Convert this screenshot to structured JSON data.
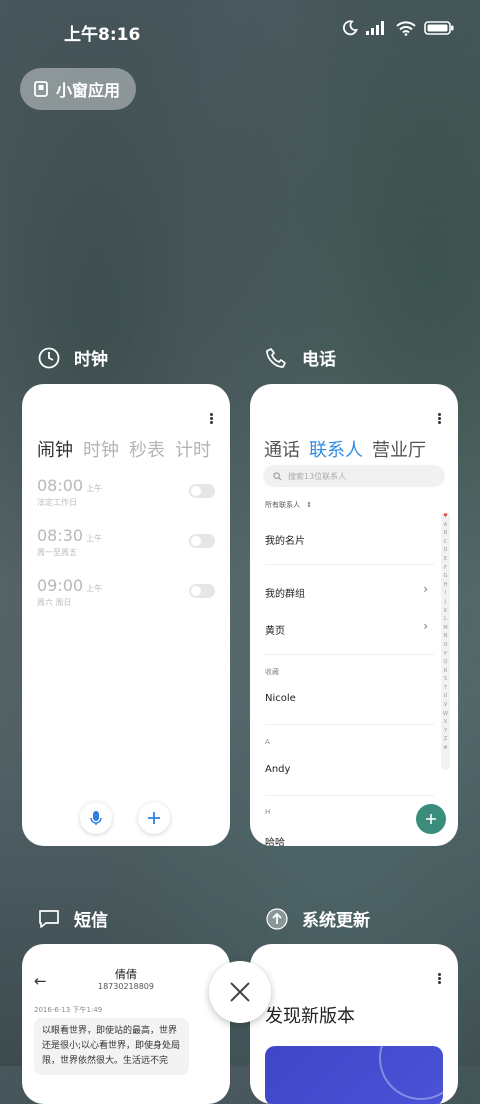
{
  "status_bar": {
    "time": "上午8:16"
  },
  "small_window_button": {
    "label": "小窗应用"
  },
  "cards": {
    "clock": {
      "app_name": "时钟",
      "tabs": [
        "闹钟",
        "时钟",
        "秒表",
        "计时"
      ],
      "alarms": [
        {
          "time": "08:00",
          "ampm": "上午",
          "repeat": "法定工作日"
        },
        {
          "time": "08:30",
          "ampm": "上午",
          "repeat": "周一至周五"
        },
        {
          "time": "09:00",
          "ampm": "上午",
          "repeat": "周六 周日"
        }
      ]
    },
    "phone": {
      "app_name": "电话",
      "tabs": [
        "通话",
        "联系人",
        "营业厅"
      ],
      "search_placeholder": "搜索13位联系人",
      "filter_label": "所有联系人",
      "my_card": "我的名片",
      "my_groups": "我的群组",
      "yellow_pages": "黄页",
      "favorites_label": "收藏",
      "favorite_contact": "Nicole",
      "section_a": "A",
      "contact_a": "Andy",
      "section_h": "H",
      "contact_h": "哈哈",
      "alphabet": [
        "♥",
        "A",
        "B",
        "C",
        "D",
        "E",
        "F",
        "G",
        "H",
        "I",
        "J",
        "K",
        "L",
        "M",
        "N",
        "O",
        "P",
        "Q",
        "R",
        "S",
        "T",
        "U",
        "V",
        "W",
        "X",
        "Y",
        "Z",
        "#"
      ]
    },
    "sms": {
      "app_name": "短信",
      "contact_name": "倩倩",
      "contact_number": "18730218809",
      "timestamp": "2016-6-13 下午1:49",
      "message": "以眼看世界，即使站的最高，世界还是很小;以心看世界，即使身处局限，世界依然很大。生活远不完"
    },
    "update": {
      "app_name": "系统更新",
      "heading": "发现新版本"
    }
  },
  "colors": {
    "accent_blue": "#2f8de6",
    "accent_green": "#3a8d7c"
  }
}
